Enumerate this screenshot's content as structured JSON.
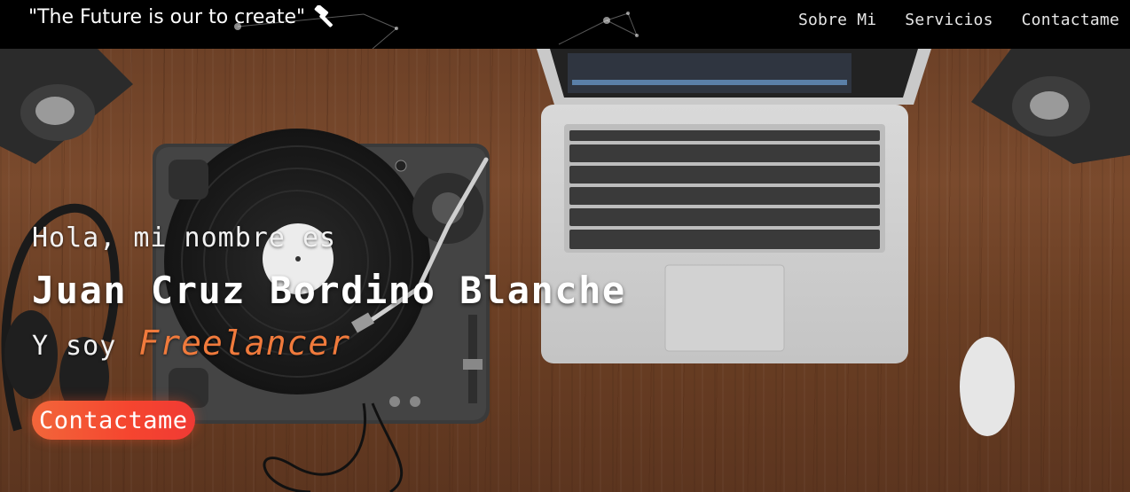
{
  "navbar": {
    "brand": "\"The Future is our to create\"",
    "brand_icon": "hammer-icon",
    "links": [
      "Sobre Mi",
      "Servicios",
      "Contactame"
    ]
  },
  "hero": {
    "greeting": "Hola, mi nombre es",
    "name": "Juan Cruz Bordino Blanche",
    "role_prefix": "Y soy",
    "role": "Freelancer",
    "cta_label": "Contactame",
    "background": "wooden-desk-dj-turntable-laptop-photo"
  },
  "colors": {
    "navbar_bg": "#000000",
    "accent": "#f07a3c",
    "cta_start": "#f2663a",
    "cta_end": "#f03a34",
    "text": "#ffffff"
  }
}
